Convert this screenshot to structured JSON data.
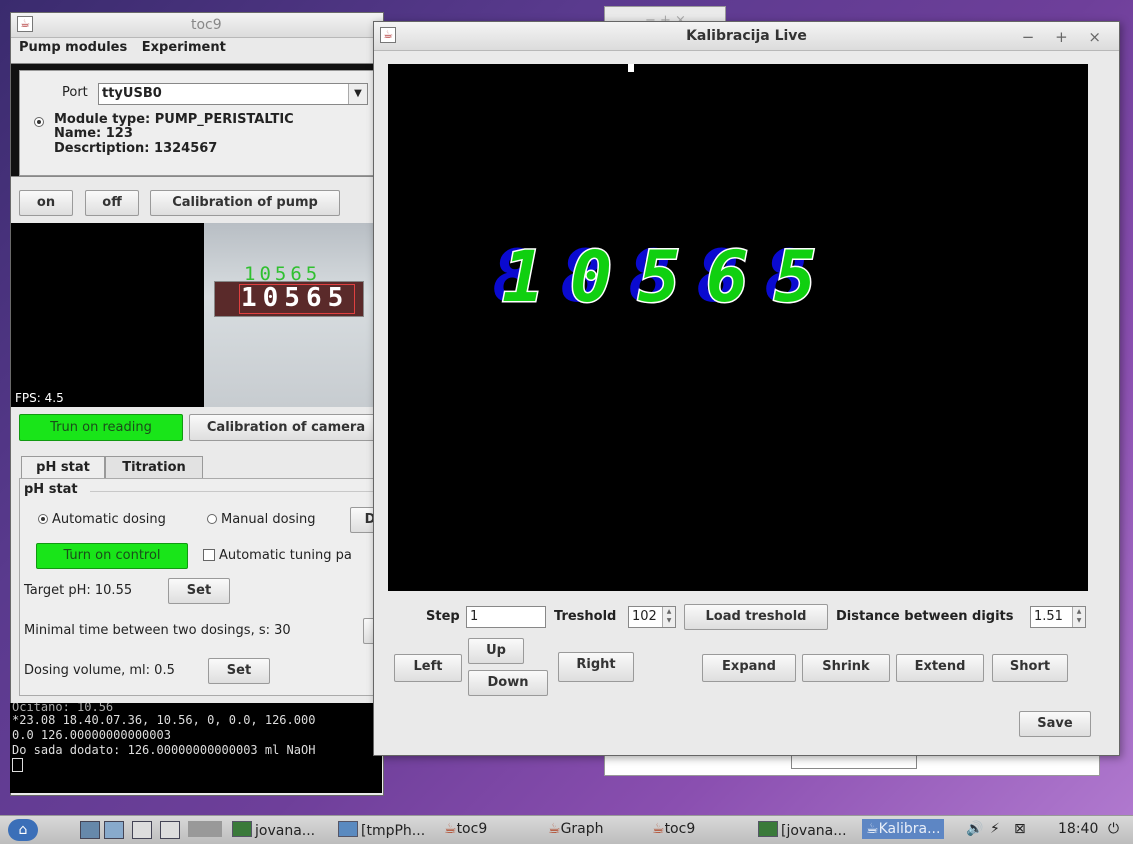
{
  "background_window": {
    "title": "toc9",
    "controls": "− + ×"
  },
  "main_window": {
    "title": "toc9",
    "menu": [
      "Pump modules",
      "Experiment"
    ],
    "port_label": "Port",
    "port_value": "ttyUSB0",
    "module_type": "Module type: PUMP_PERISTALTIC",
    "name": "Name: 123",
    "description": "Descrtiption: 1324567",
    "buttons": {
      "on": "on",
      "off": "off",
      "calibration_pump": "Calibration of pump",
      "reading": "Trun on reading",
      "calibration_camera": "Calibration of camera"
    },
    "camera_overlay_digits": "10565",
    "camera_display_digits": "10565",
    "fps": "FPS: 4.5",
    "tabs": [
      "pH stat",
      "Titration"
    ],
    "group_title": "pH stat",
    "automatic_dosing": "Automatic dosing",
    "manual_dosing": "Manual dosing",
    "d_button": "D",
    "turn_on_control": "Turn on control",
    "auto_tuning": "Automatic tuning pa",
    "target_ph": "Target pH: 10.55",
    "set": "Set",
    "min_time": "Minimal time between two dosings, s:  30",
    "dosing_volume": "Dosing volume, ml: 0.5"
  },
  "console": [
    "Ocitano: 10.56",
    "*23.08 18.40.07.36, 10.56, 0, 0.0, 126.000",
    "0.0 126.00000000000003",
    "Do sada dodato: 126.00000000000003 ml NaOH"
  ],
  "kal_window": {
    "title": "Kalibracija Live",
    "controls": "− + ×",
    "digits": [
      "1",
      "0",
      "5",
      "6",
      "5"
    ],
    "step_label": "Step",
    "step_value": "1",
    "treshold_label": "Treshold",
    "treshold_value": "102",
    "load_treshold": "Load treshold",
    "distance_label": "Distance between digits",
    "distance_value": "1.51",
    "buttons": {
      "left": "Left",
      "up": "Up",
      "down": "Down",
      "right": "Right",
      "expand": "Expand",
      "shrink": "Shrink",
      "extend": "Extend",
      "short": "Short",
      "save": "Save"
    }
  },
  "taskbar": {
    "items": [
      "jovana...",
      "[tmpPh...",
      "toc9",
      "Graph",
      "toc9",
      "[jovana...",
      "Kalibra..."
    ],
    "clock": "18:40"
  },
  "colors": {
    "green_button": "#19e519",
    "digit_green": "#10d010",
    "digit_blue": "#0a0ad0"
  }
}
